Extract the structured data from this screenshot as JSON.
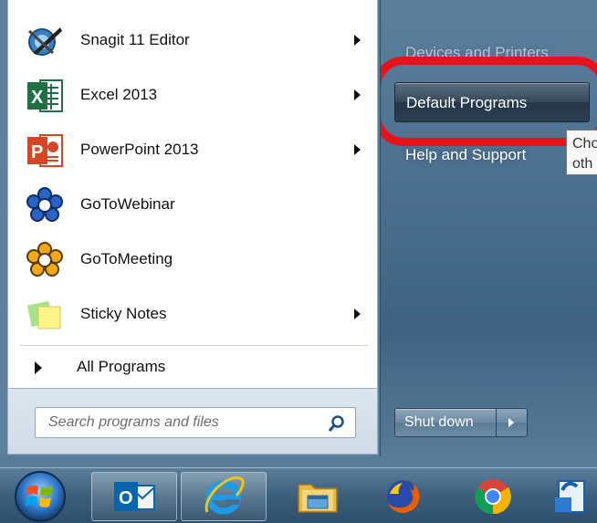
{
  "start_menu": {
    "programs": [
      {
        "label": "Snagit 11 Editor",
        "icon": "snagit-icon",
        "has_submenu": true
      },
      {
        "label": "Excel 2013",
        "icon": "excel-icon",
        "has_submenu": true
      },
      {
        "label": "PowerPoint 2013",
        "icon": "powerpoint-icon",
        "has_submenu": true
      },
      {
        "label": "GoToWebinar",
        "icon": "gotowebinar-icon",
        "has_submenu": false
      },
      {
        "label": "GoToMeeting",
        "icon": "gotomeeting-icon",
        "has_submenu": false
      },
      {
        "label": "Sticky Notes",
        "icon": "sticky-notes-icon",
        "has_submenu": true
      }
    ],
    "all_programs": "All Programs",
    "search": {
      "placeholder": "Search programs and files"
    }
  },
  "right_pane": {
    "devices_and_printers": "Devices and Printers",
    "default_programs": "Default Programs",
    "help_and_support": "Help and Support",
    "tooltip_line1": "Cho",
    "tooltip_line2": "oth",
    "shut_down": "Shut down"
  },
  "highlight": {
    "color": "#e8121b"
  },
  "taskbar": {
    "items": [
      "start-orb",
      "outlook-icon",
      "internet-explorer-icon",
      "file-explorer-icon",
      "firefox-icon",
      "chrome-icon",
      "partial-app-icon"
    ]
  }
}
